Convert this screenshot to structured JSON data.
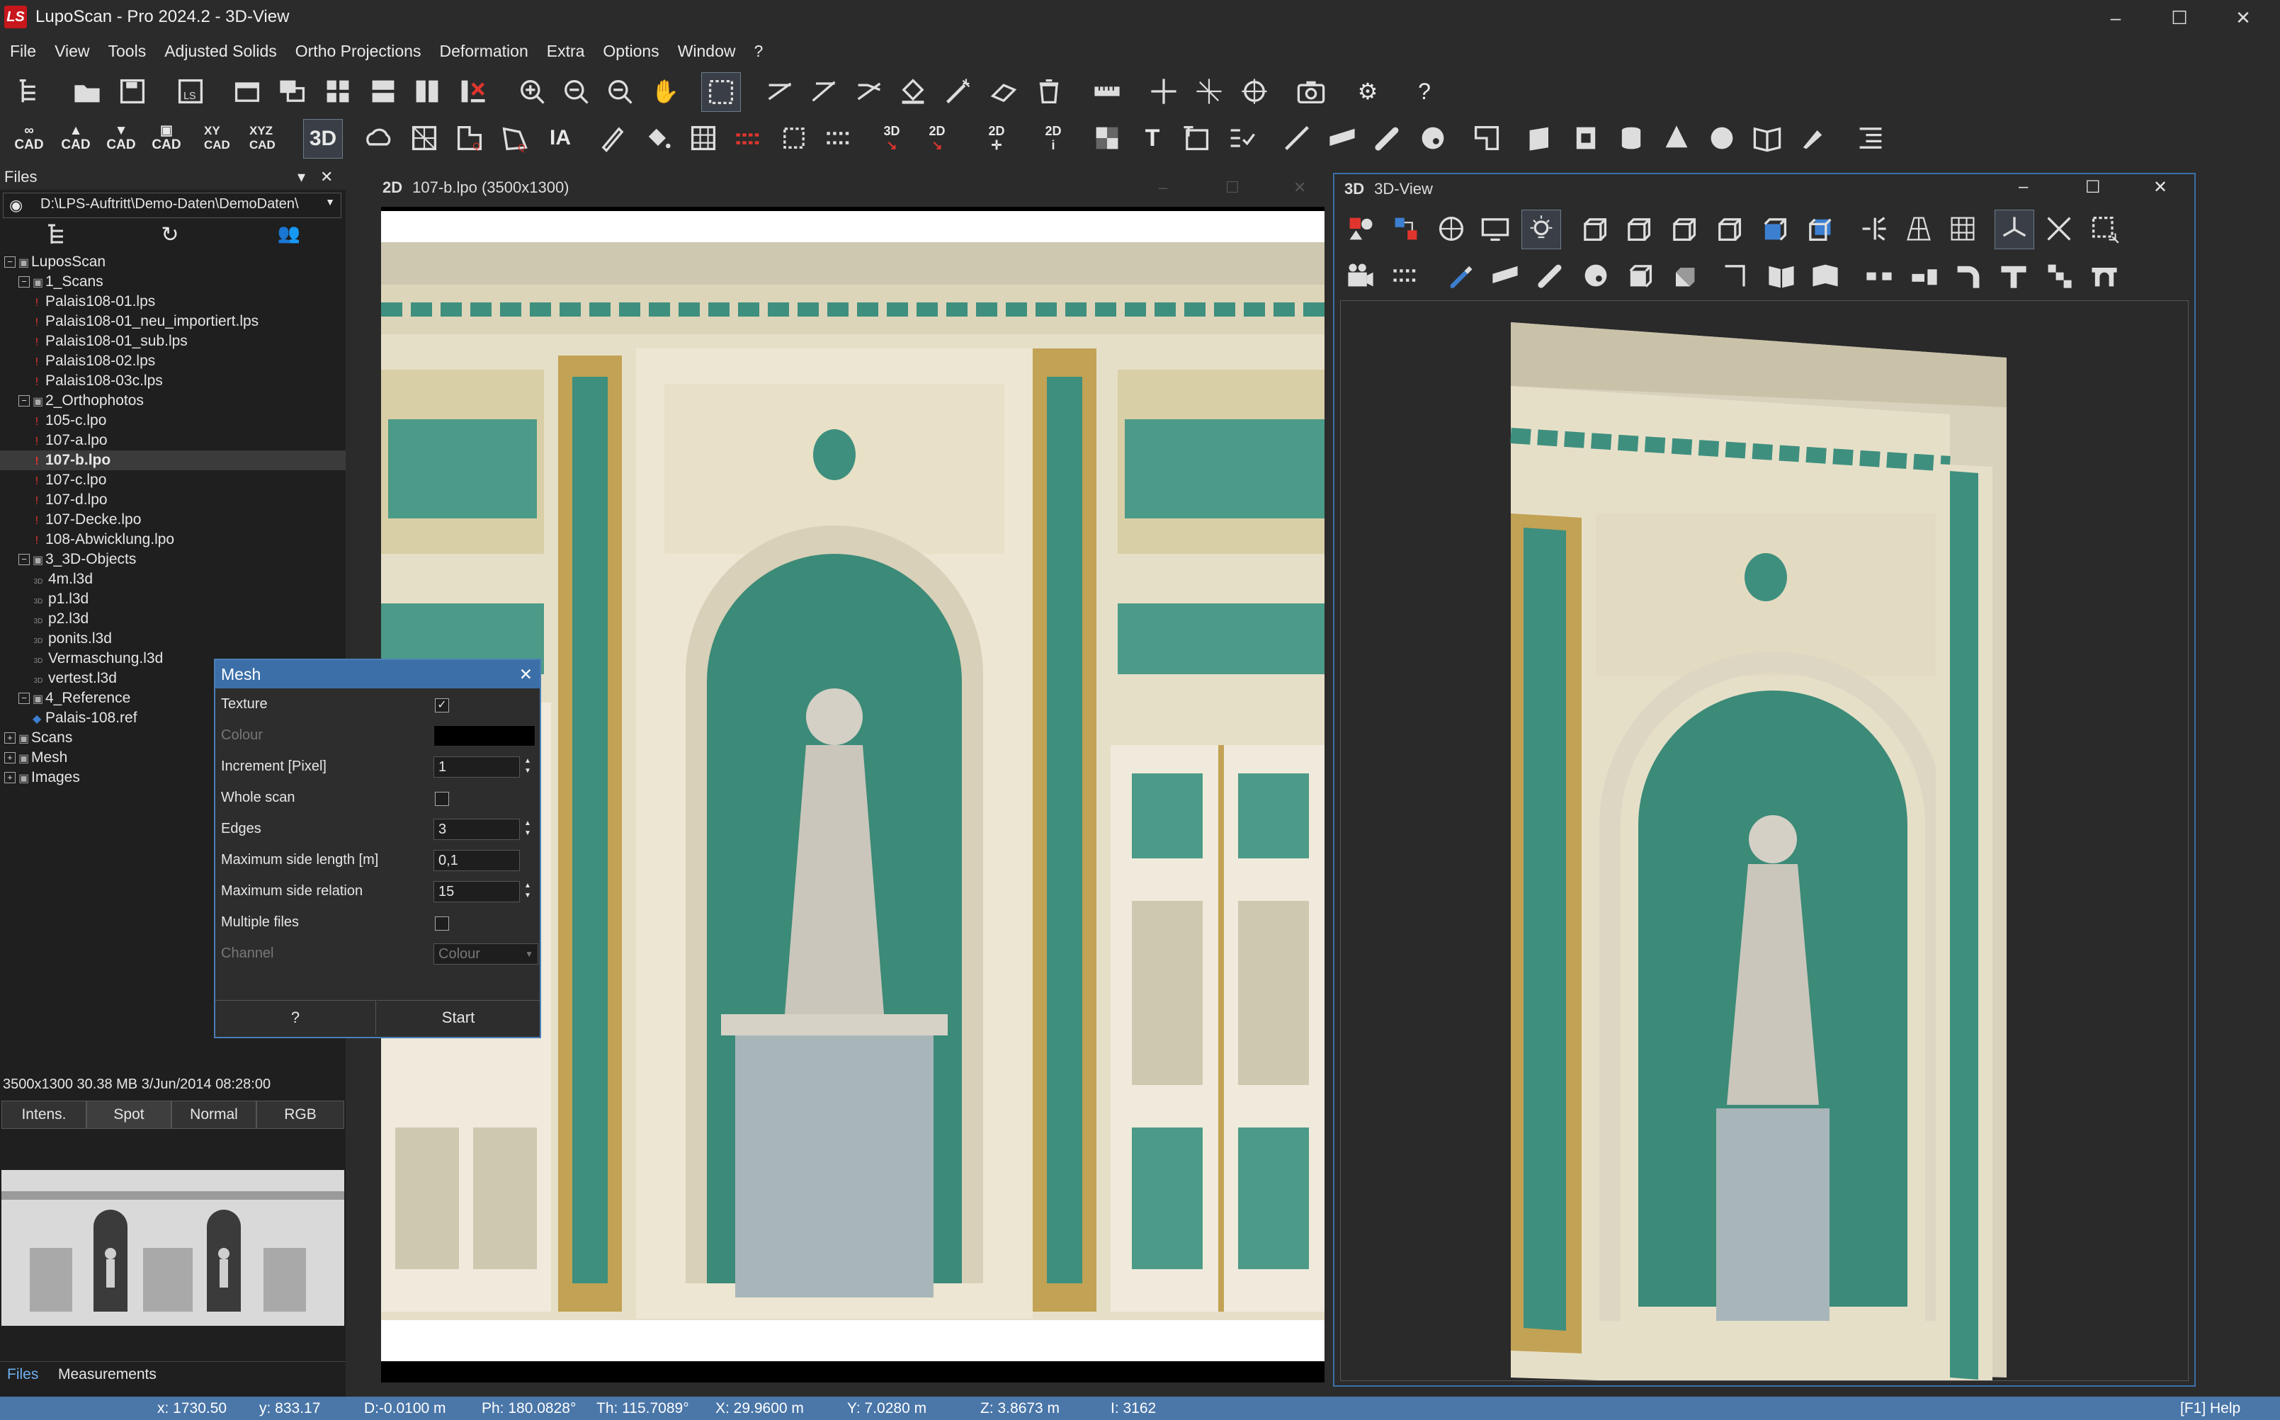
{
  "window": {
    "title": "LupoScan - Pro 2024.2 - 3D-View",
    "logo": "LS"
  },
  "menu": [
    "File",
    "View",
    "Tools",
    "Adjusted Solids",
    "Ortho Projections",
    "Deformation",
    "Extra",
    "Options",
    "Window",
    "?"
  ],
  "toolbar2_labels": {
    "cad1": "CAD",
    "cad2": "CAD",
    "cad3": "CAD",
    "cad4": "CAD",
    "xycad": "XY CAD",
    "xyzcad": "XYZ CAD",
    "mode3d": "3D",
    "ia": "IA",
    "t3d": "3D",
    "t2d": "2D",
    "t2d2": "2D",
    "t2di": "2D"
  },
  "files_panel": {
    "title": "Files",
    "path": "D:\\LPS-Auftritt\\Demo-Daten\\DemoDaten\\",
    "tree": [
      {
        "label": "LuposScan",
        "level": 0,
        "icon": "root-icon",
        "exp": "−"
      },
      {
        "label": "1_Scans",
        "level": 1,
        "icon": "folder-icon",
        "exp": "−"
      },
      {
        "label": "Palais108-01.lps",
        "level": 2,
        "icon": "scan-file-icon"
      },
      {
        "label": "Palais108-01_neu_importiert.lps",
        "level": 2,
        "icon": "scan-file-icon"
      },
      {
        "label": "Palais108-01_sub.lps",
        "level": 2,
        "icon": "scan-file-icon"
      },
      {
        "label": "Palais108-02.lps",
        "level": 2,
        "icon": "scan-file-icon"
      },
      {
        "label": "Palais108-03c.lps",
        "level": 2,
        "icon": "scan-file-icon"
      },
      {
        "label": "2_Orthophotos",
        "level": 1,
        "icon": "folder-icon",
        "exp": "−"
      },
      {
        "label": "105-c.lpo",
        "level": 2,
        "icon": "ortho-file-icon"
      },
      {
        "label": "107-a.lpo",
        "level": 2,
        "icon": "ortho-file-icon"
      },
      {
        "label": "107-b.lpo",
        "level": 2,
        "icon": "ortho-file-icon",
        "selected": true
      },
      {
        "label": "107-c.lpo",
        "level": 2,
        "icon": "ortho-file-icon"
      },
      {
        "label": "107-d.lpo",
        "level": 2,
        "icon": "ortho-file-icon"
      },
      {
        "label": "107-Decke.lpo",
        "level": 2,
        "icon": "ortho-file-icon"
      },
      {
        "label": "108-Abwicklung.lpo",
        "level": 2,
        "icon": "ortho-file-icon"
      },
      {
        "label": "3_3D-Objects",
        "level": 1,
        "icon": "folder-icon",
        "exp": "−"
      },
      {
        "label": "4m.l3d",
        "level": 2,
        "icon": "object-3d-icon"
      },
      {
        "label": "p1.l3d",
        "level": 2,
        "icon": "object-3d-icon"
      },
      {
        "label": "p2.l3d",
        "level": 2,
        "icon": "object-3d-icon"
      },
      {
        "label": "ponits.l3d",
        "level": 2,
        "icon": "object-3d-icon"
      },
      {
        "label": "Vermaschung.l3d",
        "level": 2,
        "icon": "object-3d-icon"
      },
      {
        "label": "vertest.l3d",
        "level": 2,
        "icon": "object-3d-icon"
      },
      {
        "label": "4_Reference",
        "level": 1,
        "icon": "folder-icon",
        "exp": "−"
      },
      {
        "label": "Palais-108.ref",
        "level": 2,
        "icon": "reference-file-icon"
      },
      {
        "label": "Scans",
        "level": 0,
        "icon": "scans-icon",
        "exp": "+"
      },
      {
        "label": "Mesh",
        "level": 0,
        "icon": "mesh-icon",
        "exp": "+"
      },
      {
        "label": "Images",
        "level": 0,
        "icon": "images-icon",
        "exp": "+"
      }
    ],
    "info": "3500x1300   30.38 MB  3/Jun/2014  08:28:00",
    "view_modes": [
      "Intens.",
      "Spot",
      "Normal",
      "RGB"
    ],
    "bottom_tabs": [
      "Files",
      "Measurements"
    ]
  },
  "mesh_dialog": {
    "title": "Mesh",
    "rows": {
      "texture": {
        "label": "Texture",
        "checked": "✓"
      },
      "colour": {
        "label": "Colour"
      },
      "increment": {
        "label": "Increment [Pixel]",
        "value": "1"
      },
      "whole_scan": {
        "label": "Whole scan"
      },
      "edges": {
        "label": "Edges",
        "value": "3"
      },
      "max_side_length": {
        "label": "Maximum side length [m]",
        "value": "0,1"
      },
      "max_side_relation": {
        "label": "Maximum side relation",
        "value": "15"
      },
      "multiple_files": {
        "label": "Multiple files"
      },
      "channel": {
        "label": "Channel",
        "value": "Colour"
      }
    },
    "help_button": "?",
    "start_button": "Start"
  },
  "view2d": {
    "tag": "2D",
    "title": "107-b.lpo (3500x1300)"
  },
  "view3d": {
    "tag": "3D",
    "title": "3D-View"
  },
  "status": {
    "x": "x:   1730.50",
    "y": "y:   833.17",
    "d": "D:-0.0100 m",
    "ph": "Ph: 180.0828°",
    "th": "Th: 115.7089°",
    "X": "X:  29.9600 m",
    "Y": "Y:    7.0280 m",
    "Z": "Z:   3.8673 m",
    "i": "I: 3162",
    "help": "[F1] Help"
  },
  "colors": {
    "accent": "#3c6fa8",
    "status": "#4a76a8",
    "wall_green": "#3f8f7e",
    "wall_cream": "#e6dfc8"
  }
}
